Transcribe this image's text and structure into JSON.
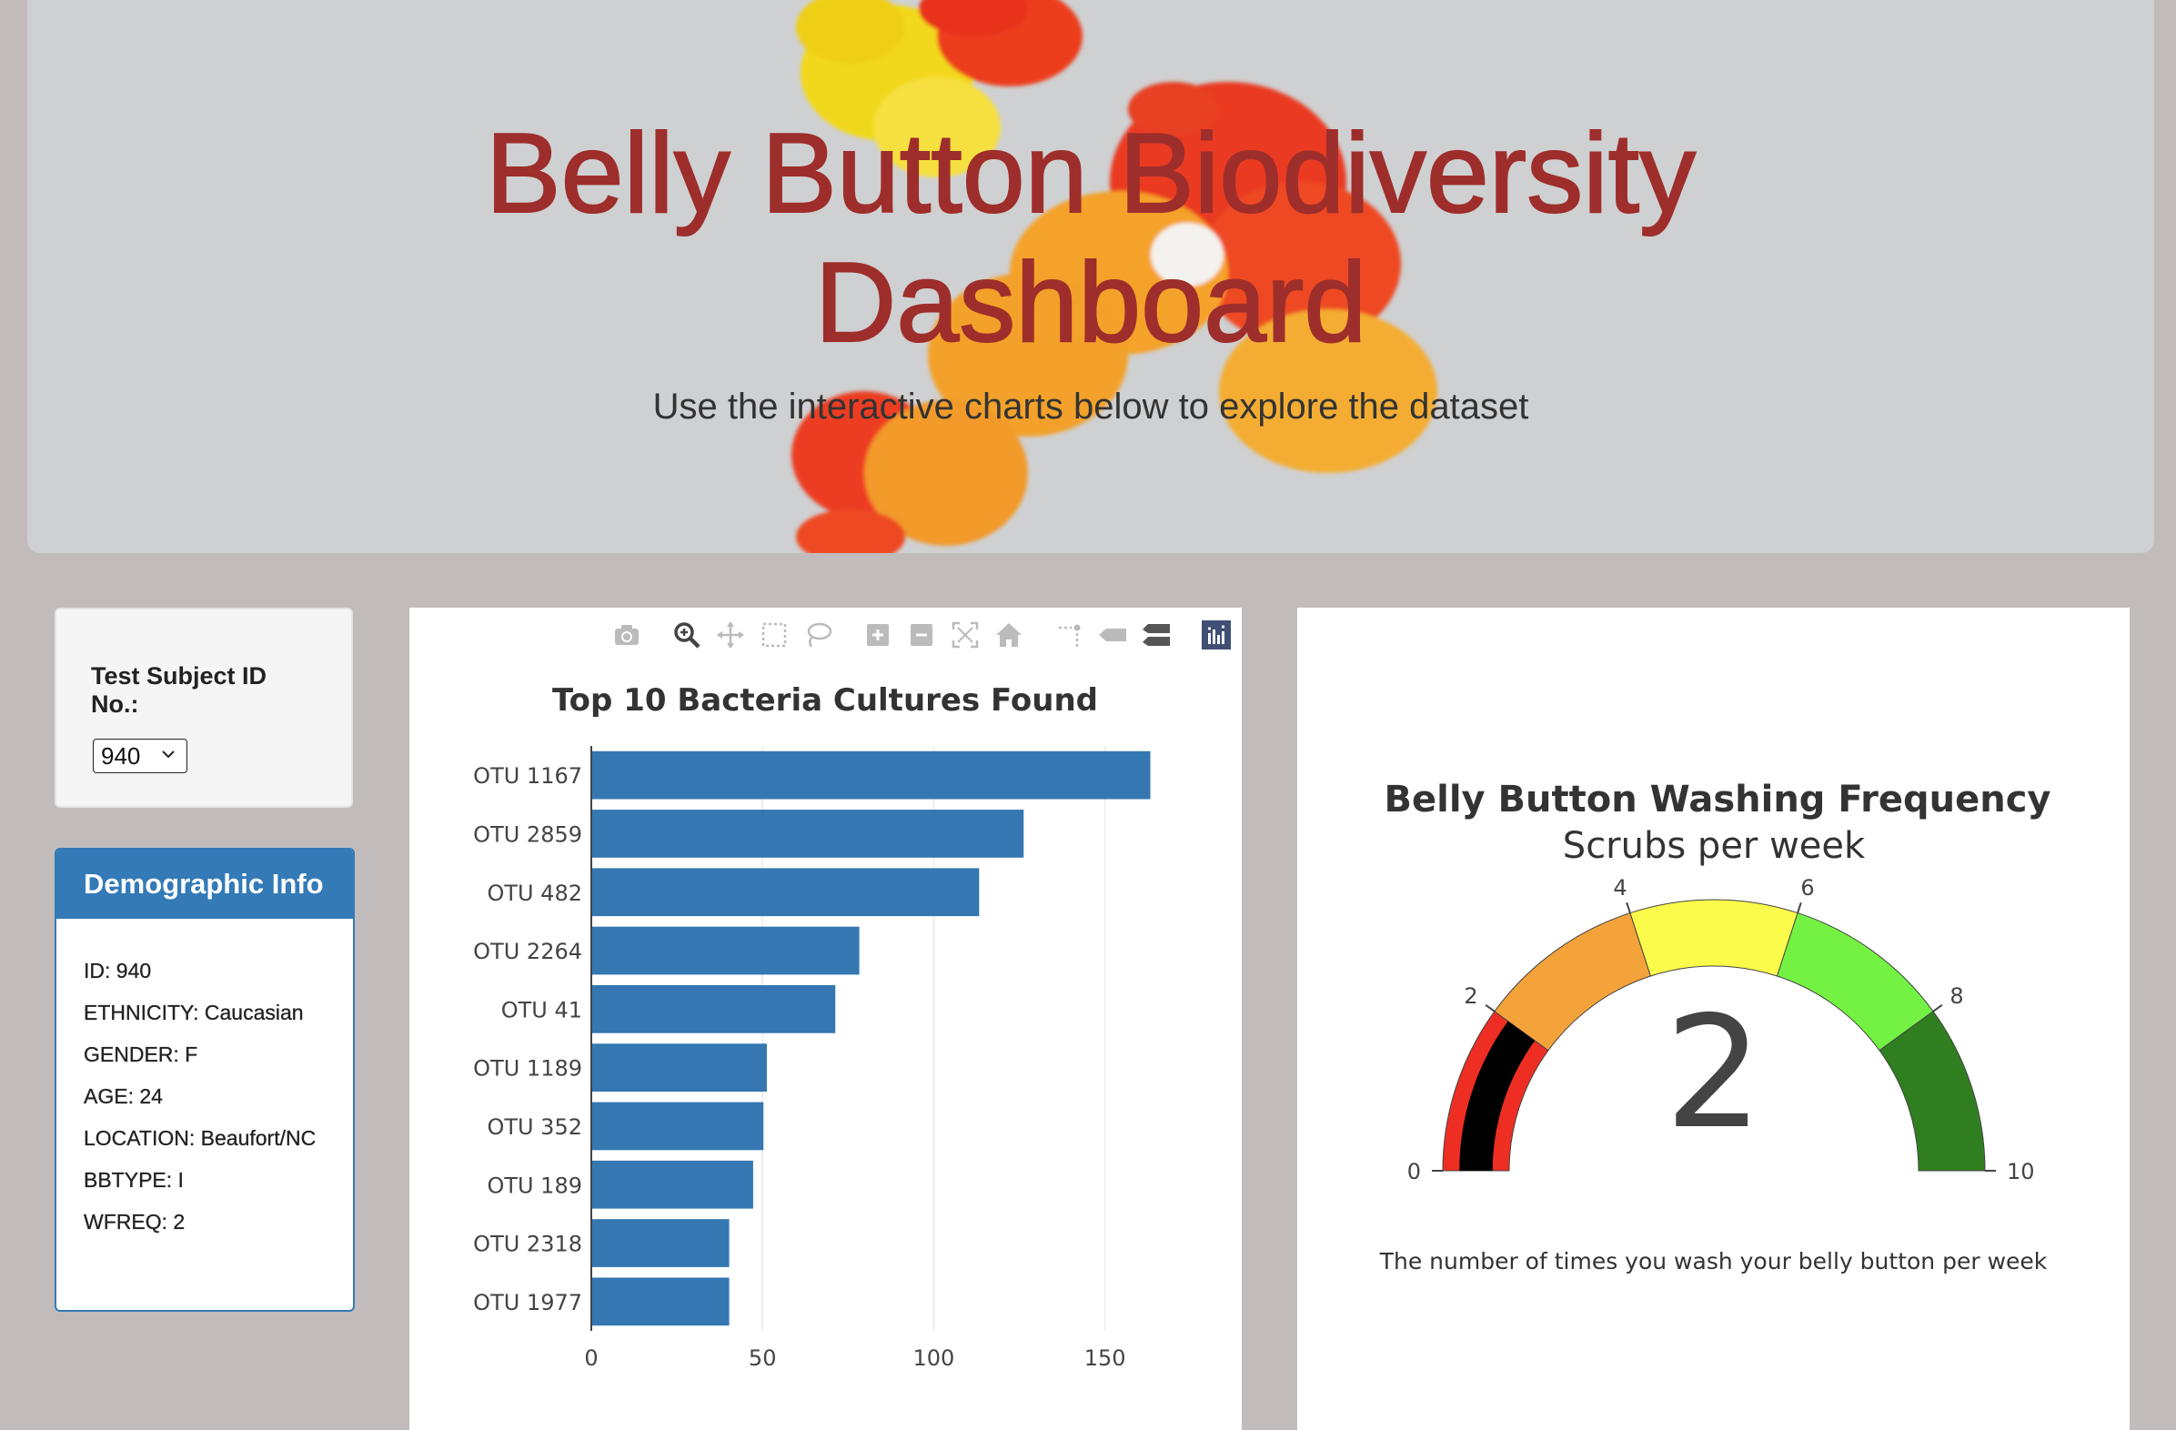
{
  "header": {
    "title_line1": "Belly Button Biodiversity",
    "title_line2": "Dashboard",
    "subtitle": "Use the interactive charts below to explore the dataset"
  },
  "selector": {
    "label": "Test Subject ID No.:",
    "selected_value": "940"
  },
  "demographics": {
    "heading": "Demographic Info",
    "items": [
      "ID: 940",
      "ETHNICITY: Caucasian",
      "GENDER: F",
      "AGE: 24",
      "LOCATION: Beaufort/NC",
      "BBTYPE: I",
      "WFREQ: 2"
    ]
  },
  "modebar": {
    "icons": [
      "camera-icon",
      "zoom-icon",
      "pan-icon",
      "box-select-icon",
      "lasso-select-icon",
      "zoom-in-icon",
      "zoom-out-icon",
      "autoscale-icon",
      "reset-axes-icon",
      "spike-lines-icon",
      "hover-closest-icon",
      "hover-compare-icon",
      "plotly-logo-icon"
    ]
  },
  "colors": {
    "bar": "#3477b1",
    "title_red": "#9e2e2b",
    "panel_blue": "#337ab7",
    "gauge_needle_bar": "#000000"
  },
  "chart_data": [
    {
      "type": "bar",
      "orientation": "horizontal",
      "title": "Top 10 Bacteria Cultures Found",
      "categories": [
        "OTU 1167",
        "OTU 2859",
        "OTU 482",
        "OTU 2264",
        "OTU 41",
        "OTU 1189",
        "OTU 352",
        "OTU 189",
        "OTU 2318",
        "OTU 1977"
      ],
      "values": [
        163,
        126,
        113,
        78,
        71,
        51,
        50,
        47,
        40,
        40
      ],
      "x_ticks": [
        0,
        50,
        100,
        150
      ],
      "xlim": [
        0,
        178
      ],
      "grid": true
    },
    {
      "type": "gauge",
      "title": "Belly Button Washing Frequency",
      "subtitle": "Scrubs per week",
      "value": 2,
      "range": [
        0,
        10
      ],
      "ticks": [
        0,
        2,
        4,
        6,
        8,
        10
      ],
      "steps": [
        {
          "range": [
            0,
            2
          ],
          "color": "#ee2e22"
        },
        {
          "range": [
            2,
            4
          ],
          "color": "#f4a23a"
        },
        {
          "range": [
            4,
            6
          ],
          "color": "#fbfb4b"
        },
        {
          "range": [
            6,
            8
          ],
          "color": "#73f244"
        },
        {
          "range": [
            8,
            10
          ],
          "color": "#2f7f21"
        }
      ],
      "caption": "The number of times you wash your belly button per week"
    }
  ]
}
